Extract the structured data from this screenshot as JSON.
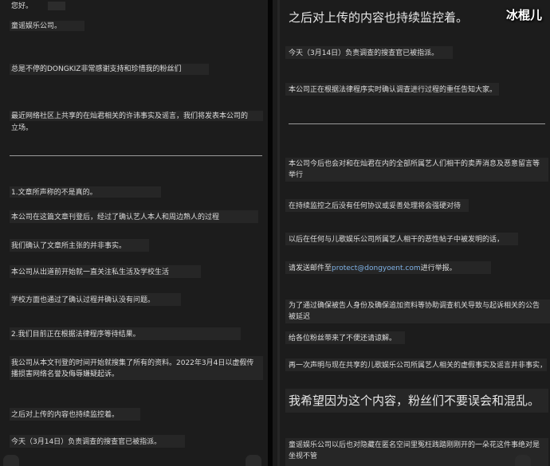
{
  "left": {
    "greeting": "您好。",
    "company": "童谣娱乐公司。",
    "p1": "总是不停的DONGKIZ非常感谢支持和珍惜我的粉丝们",
    "p2a": "最近网络社区上共享的在灿君相关的许讳事实及谣言，我们将发表本公司的",
    "p2b": "立场。",
    "s1_title": "1.文章所声称的不是真的。",
    "s1_l1": "本公司在这篇文章刊登后，经过了确认艺人本人和周边熟人的过程",
    "s1_l2": "我们确认了文章所主张的并非事实。",
    "s1_l3": "本公司从出道前开始就一直关注私生活及学校生活",
    "s1_l4": "学校方面也通过了确认过程并确认没有问题。",
    "s2_title": "2.我们目前正在根据法律程序等待结果。",
    "s2_l1a": "我公司从本文刊登的时间开始就搜集了所有的资料。2022年3月4日以虚假传",
    "s2_l1b": "播损害网络名誉及侮辱嫌疑起诉。",
    "s2_l2": "之后对上传的内容也持续监控着。",
    "s2_l3": "今天（3月14日）负责调查的搜查官已被指派。"
  },
  "right": {
    "watermark": "冰棍儿",
    "heading": "之后对上传的内容也持续监控着。",
    "r1": "今天（3月14日）负责调查的搜查官已被指派。",
    "r2": "本公司正在根据法律程序实时确认调查进行过程的重任告知大家。",
    "r3a": "本公司今后也会对和在灿君在内的全部所属艺人们相干的卖弄消息及恶意留言等",
    "r3b": "举行",
    "r4": "在持续监控之后没有任何协议或妥善处理将会强硬对待",
    "r5": "以后在任何与儿歌娱乐公司所属艺人相干的恶性帖子中被发明的话，",
    "r6_pre": "请发送邮件至",
    "r6_email": "protect@dongyoent.com",
    "r6_post": "进行举报。",
    "r7a": "为了通过确保被告人身份及确保追加资料等协助调查机关导致与起诉相关的公告",
    "r7b": "被延迟",
    "r8": "给各位粉丝带来了不便还请谅解。",
    "r9": "再一次声明与现在共享的儿歌娱乐公司所属艺人相关的虚假事实及谣言并非事实，",
    "big2": "我希望因为这个内容，粉丝们不要误会和混乱。",
    "r10a": "童谣娱乐公司以后也对隐藏在匿名空间里冤枉践踏刚刚开的一朵花这件事绝对是",
    "r10b": "坐视不管"
  }
}
